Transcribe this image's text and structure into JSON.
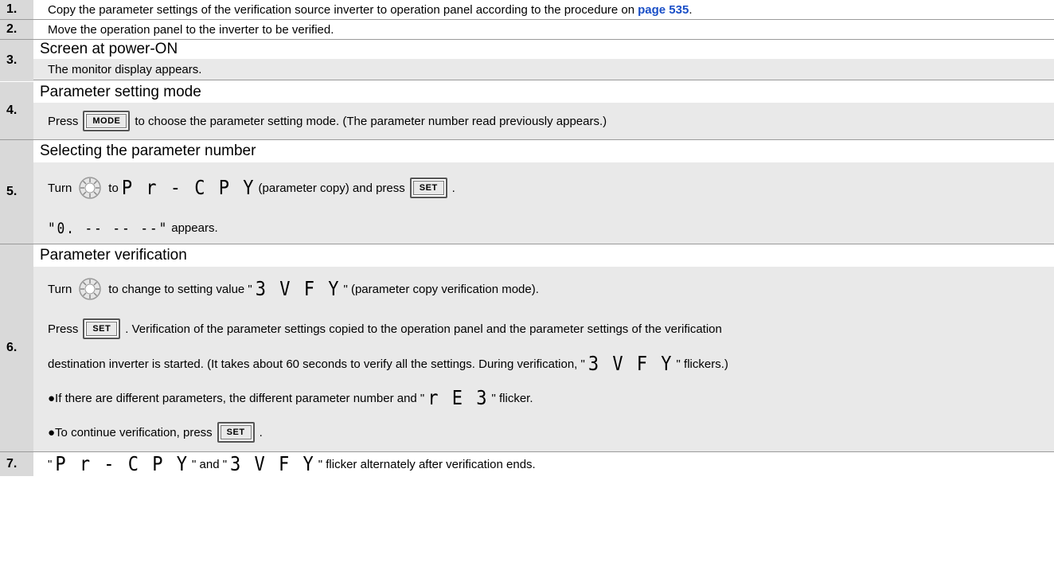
{
  "steps": [
    {
      "num": "1.",
      "text_a": "Copy the parameter settings of the verification source inverter to operation panel according to the procedure on ",
      "link": "page 535",
      "text_b": "."
    },
    {
      "num": "2.",
      "text": "Move the operation panel to the inverter to be verified."
    },
    {
      "num": "3.",
      "title": "Screen at power-ON",
      "text": "The monitor display appears."
    },
    {
      "num": "4.",
      "title": "Parameter setting mode",
      "text_a": "Press",
      "key": "MODE",
      "text_b": "to choose the parameter setting mode. (The parameter number read previously appears.)"
    },
    {
      "num": "5.",
      "title": "Selecting the parameter number",
      "l1_a": "Turn",
      "l1_b": "to",
      "l1_seg": "P r - C P Y",
      "l1_c": "(parameter copy) and press",
      "l1_key": "SET",
      "l1_d": ".",
      "l2_seg": "\"0. -- -- --\"",
      "l2_a": " appears."
    },
    {
      "num": "6.",
      "title": "Parameter verification",
      "l1_a": "Turn",
      "l1_b": "to change to setting value \"",
      "l1_seg": "3 V F Y",
      "l1_c": "\" (parameter copy verification mode).",
      "l2_a": "Press",
      "l2_key": "SET",
      "l2_b": ". Verification of the parameter settings copied to the operation panel and the parameter settings of the verification",
      "l3_a": "destination inverter is started. (It takes about 60 seconds to verify all the settings. During verification, \"",
      "l3_seg": "3 V F Y",
      "l3_b": "\" flickers.)",
      "l4_a": "●If there are different parameters, the different parameter number and \"",
      "l4_seg": "r E 3",
      "l4_b": "\" flicker.",
      "l5_a": "●To continue verification, press",
      "l5_key": "SET",
      "l5_b": "."
    },
    {
      "num": "7.",
      "text_a": "\"",
      "seg1": "P r - C P Y",
      "text_b": "\" and \"",
      "seg2": "3 V F Y",
      "text_c": "\" flicker alternately after verification ends."
    }
  ]
}
